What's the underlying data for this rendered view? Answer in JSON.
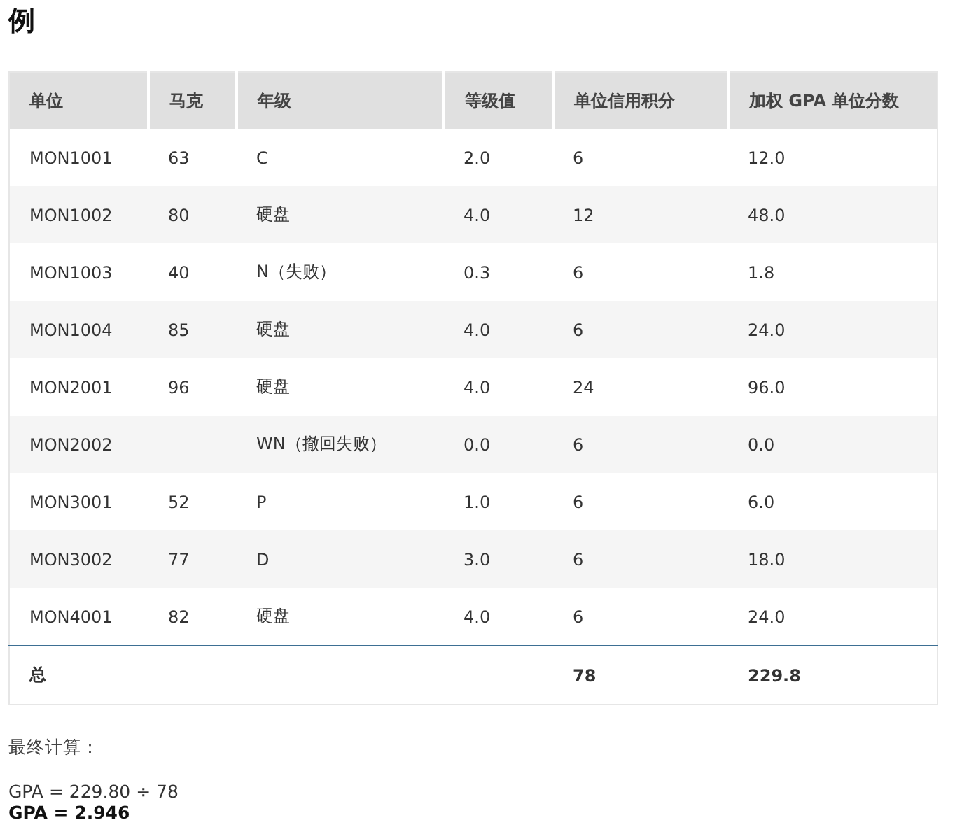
{
  "title": "例",
  "table": {
    "columns": [
      "单位",
      "马克",
      "年级",
      "等级值",
      "单位信用积分",
      "加权 GPA 单位分数"
    ],
    "rows": [
      {
        "unit": "MON1001",
        "mark": "63",
        "grade": "C",
        "grade_value": "2.0",
        "credits": "6",
        "weighted": "12.0"
      },
      {
        "unit": "MON1002",
        "mark": "80",
        "grade": "硬盘",
        "grade_value": "4.0",
        "credits": "12",
        "weighted": "48.0"
      },
      {
        "unit": "MON1003",
        "mark": "40",
        "grade": "N（失败）",
        "grade_value": "0.3",
        "credits": "6",
        "weighted": "1.8"
      },
      {
        "unit": "MON1004",
        "mark": "85",
        "grade": "硬盘",
        "grade_value": "4.0",
        "credits": "6",
        "weighted": "24.0"
      },
      {
        "unit": "MON2001",
        "mark": "96",
        "grade": "硬盘",
        "grade_value": "4.0",
        "credits": "24",
        "weighted": "96.0"
      },
      {
        "unit": "MON2002",
        "grade": "WN（撤回失败）",
        "grade_value": "0.0",
        "credits": "6",
        "weighted": "0.0"
      },
      {
        "unit": "MON3001",
        "mark": "52",
        "grade": "P",
        "grade_value": "1.0",
        "credits": "6",
        "weighted": "6.0"
      },
      {
        "unit": "MON3002",
        "mark": "77",
        "grade": "D",
        "grade_value": "3.0",
        "credits": "6",
        "weighted": "18.0"
      },
      {
        "unit": "MON4001",
        "mark": "82",
        "grade": "硬盘",
        "grade_value": "4.0",
        "credits": "6",
        "weighted": "24.0"
      }
    ],
    "total": {
      "label": "总",
      "credits": "78",
      "weighted": "229.8"
    }
  },
  "calc_heading": "最终计算：",
  "calc_line": "GPA = 229.80 ÷ 78",
  "result": "GPA = 2.946"
}
